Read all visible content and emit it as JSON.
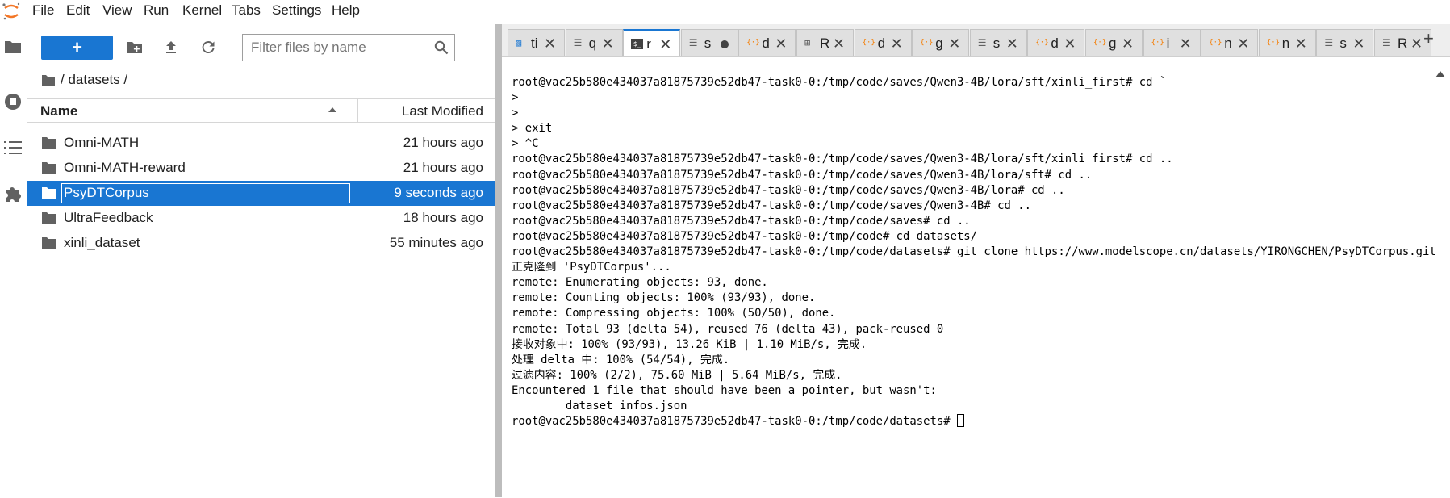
{
  "menubar": {
    "items": [
      "File",
      "Edit",
      "View",
      "Run",
      "Kernel",
      "Tabs",
      "Settings",
      "Help"
    ]
  },
  "file_browser": {
    "new_button_label": "+",
    "filter_placeholder": "Filter files by name",
    "breadcrumb": "/ datasets /",
    "columns": {
      "name": "Name",
      "modified": "Last Modified"
    },
    "files": [
      {
        "name": "Omni-MATH",
        "modified": "21 hours ago",
        "selected": false
      },
      {
        "name": "Omni-MATH-reward",
        "modified": "21 hours ago",
        "selected": false
      },
      {
        "name": "PsyDTCorpus",
        "modified": "9 seconds ago",
        "selected": true
      },
      {
        "name": "UltraFeedback",
        "modified": "18 hours ago",
        "selected": false
      },
      {
        "name": "xinli_dataset",
        "modified": "55 minutes ago",
        "selected": false
      }
    ]
  },
  "tabs": [
    {
      "label": "ti",
      "icon": "image-icon",
      "active": false
    },
    {
      "label": "q",
      "icon": "text-file-icon",
      "active": false
    },
    {
      "label": "r",
      "icon": "terminal-icon",
      "active": true
    },
    {
      "label": "s",
      "icon": "text-file-icon",
      "active": false,
      "modified": true
    },
    {
      "label": "d",
      "icon": "json-icon",
      "active": false
    },
    {
      "label": "R",
      "icon": "markdown-icon",
      "active": false
    },
    {
      "label": "d",
      "icon": "json-icon",
      "active": false
    },
    {
      "label": "g",
      "icon": "json-icon",
      "active": false
    },
    {
      "label": "s",
      "icon": "text-file-icon",
      "active": false
    },
    {
      "label": "d",
      "icon": "json-icon",
      "active": false
    },
    {
      "label": "g",
      "icon": "json-icon",
      "active": false
    },
    {
      "label": "i",
      "icon": "json-icon",
      "active": false
    },
    {
      "label": "n",
      "icon": "json-icon",
      "active": false
    },
    {
      "label": "n",
      "icon": "json-icon",
      "active": false
    },
    {
      "label": "s",
      "icon": "text-file-icon",
      "active": false
    },
    {
      "label": "R",
      "icon": "text-file-icon",
      "active": false
    }
  ],
  "add_tab_label": "+",
  "terminal": {
    "lines": [
      "root@vac25b580e434037a81875739e52db47-task0-0:/tmp/code/saves/Qwen3-4B/lora/sft/xinli_first# cd `",
      ">",
      ">",
      "> exit",
      "> ^C",
      "root@vac25b580e434037a81875739e52db47-task0-0:/tmp/code/saves/Qwen3-4B/lora/sft/xinli_first# cd ..",
      "root@vac25b580e434037a81875739e52db47-task0-0:/tmp/code/saves/Qwen3-4B/lora/sft# cd ..",
      "root@vac25b580e434037a81875739e52db47-task0-0:/tmp/code/saves/Qwen3-4B/lora# cd ..",
      "root@vac25b580e434037a81875739e52db47-task0-0:/tmp/code/saves/Qwen3-4B# cd ..",
      "root@vac25b580e434037a81875739e52db47-task0-0:/tmp/code/saves# cd ..",
      "root@vac25b580e434037a81875739e52db47-task0-0:/tmp/code# cd datasets/",
      "root@vac25b580e434037a81875739e52db47-task0-0:/tmp/code/datasets# git clone https://www.modelscope.cn/datasets/YIRONGCHEN/PsyDTCorpus.git",
      "正克隆到 'PsyDTCorpus'...",
      "remote: Enumerating objects: 93, done.",
      "remote: Counting objects: 100% (93/93), done.",
      "remote: Compressing objects: 100% (50/50), done.",
      "remote: Total 93 (delta 54), reused 76 (delta 43), pack-reused 0",
      "接收对象中: 100% (93/93), 13.26 KiB | 1.10 MiB/s, 完成.",
      "处理 delta 中: 100% (54/54), 完成.",
      "过滤内容: 100% (2/2), 75.60 MiB | 5.64 MiB/s, 完成.",
      "Encountered 1 file that should have been a pointer, but wasn't:",
      "        dataset_infos.json"
    ],
    "prompt": "root@vac25b580e434037a81875739e52db47-task0-0:/tmp/code/datasets# "
  },
  "colors": {
    "accent": "#1976d2",
    "json_icon": "#f57c00",
    "icon_gray": "#616161"
  }
}
